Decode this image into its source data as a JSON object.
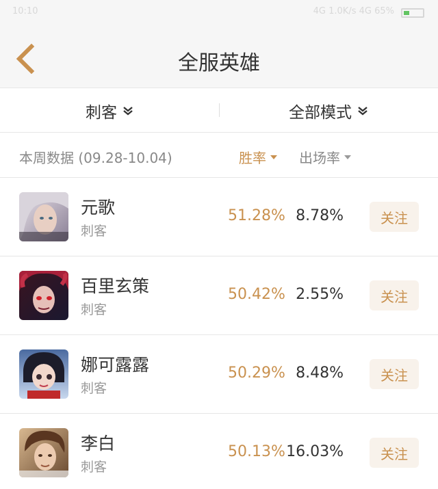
{
  "status_bar": {
    "time": "10:10",
    "info": "4G  1.0K/s  4G  65%"
  },
  "header": {
    "title": "全服英雄"
  },
  "filters": {
    "role": "刺客",
    "mode": "全部模式"
  },
  "table_header": {
    "week_label": "本周数据 (09.28-10.04)",
    "winrate_label": "胜率",
    "pickrate_label": "出场率"
  },
  "heroes": [
    {
      "name": "元歌",
      "role": "刺客",
      "winrate": "51.28%",
      "pickrate": "8.78%",
      "follow_label": "关注"
    },
    {
      "name": "百里玄策",
      "role": "刺客",
      "winrate": "50.42%",
      "pickrate": "2.55%",
      "follow_label": "关注"
    },
    {
      "name": "娜可露露",
      "role": "刺客",
      "winrate": "50.29%",
      "pickrate": "8.48%",
      "follow_label": "关注"
    },
    {
      "name": "李白",
      "role": "刺客",
      "winrate": "50.13%",
      "pickrate": "16.03%",
      "follow_label": "关注"
    }
  ],
  "colors": {
    "accent": "#c9914f",
    "follow_bg": "#f8f2eb",
    "header_bg": "#f6f6f6"
  }
}
